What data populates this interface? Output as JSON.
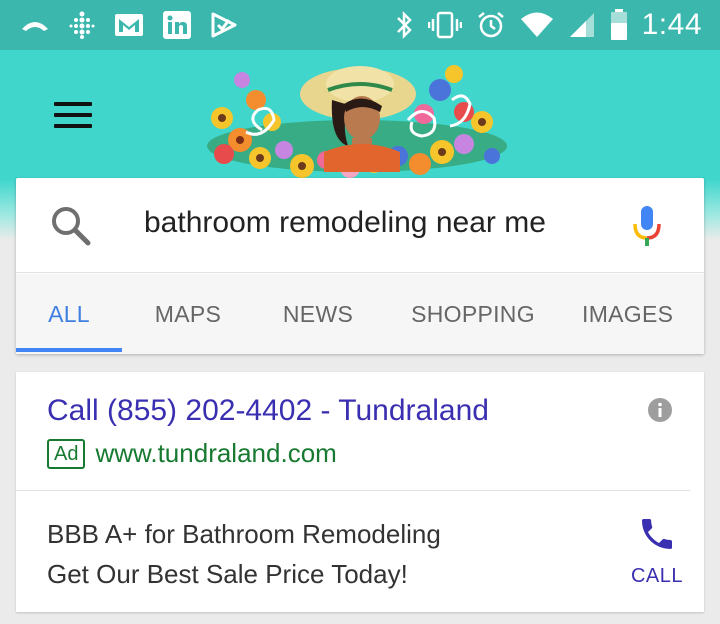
{
  "status_bar": {
    "left_icons": [
      "missed-call-icon",
      "dots-grid-icon",
      "gmail-icon",
      "linkedin-icon",
      "checkmark-app-icon"
    ],
    "right_icons": [
      "bluetooth-icon",
      "vibrate-icon",
      "alarm-icon",
      "wifi-icon",
      "cell-signal-icon",
      "battery-icon"
    ],
    "time": "1:44"
  },
  "header": {
    "menu_icon": "hamburger-menu-icon",
    "doodle_icon": "google-doodle-icon"
  },
  "search": {
    "query": "bathroom remodeling near me",
    "search_icon": "search-icon",
    "mic_icon": "microphone-icon"
  },
  "tabs": [
    {
      "label": "ALL",
      "active": true
    },
    {
      "label": "MAPS",
      "active": false
    },
    {
      "label": "NEWS",
      "active": false
    },
    {
      "label": "SHOPPING",
      "active": false
    },
    {
      "label": "IMAGES",
      "active": false
    }
  ],
  "ad": {
    "title": "Call (855) 202-4402 - Tundraland",
    "badge": "Ad",
    "url": "www.tundraland.com",
    "description_line1": "BBB A+ for Bathroom Remodeling",
    "description_line2": "Get Our Best Sale Price Today!",
    "call_label": "CALL",
    "info_icon": "info-icon",
    "phone_icon": "phone-icon"
  },
  "colors": {
    "status_bar": "#3bb7ad",
    "header": "#40d6cc",
    "accent_blue": "#4285f4",
    "ad_title": "#3a2fb0",
    "ad_green": "#177a30"
  }
}
